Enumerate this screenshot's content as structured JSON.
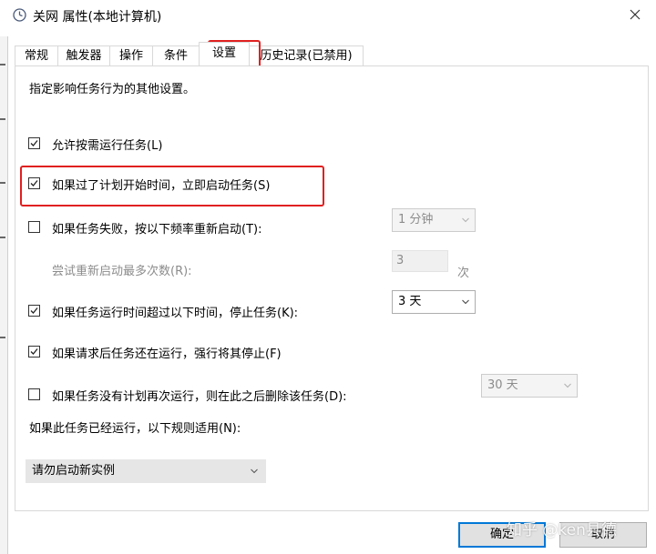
{
  "window": {
    "title": "关网 属性(本地计算机)"
  },
  "tabs": [
    {
      "label": "常规"
    },
    {
      "label": "触发器"
    },
    {
      "label": "操作"
    },
    {
      "label": "条件"
    },
    {
      "label": "设置",
      "active": true
    },
    {
      "label": "历史记录(已禁用)"
    }
  ],
  "settings": {
    "description": "指定影响任务行为的其他设置。",
    "allow_on_demand": {
      "label": "允许按需运行任务(L)",
      "checked": true
    },
    "run_asap_missed": {
      "label": "如果过了计划开始时间，立即启动任务(S)",
      "checked": true
    },
    "restart_on_fail": {
      "label": "如果任务失败，按以下频率重新启动(T):",
      "checked": false,
      "interval_value": "1 分钟",
      "attempts_label": "尝试重新启动最多次数(R):",
      "attempts_value": "3",
      "attempts_unit": "次"
    },
    "stop_if_longer": {
      "label": "如果任务运行时间超过以下时间，停止任务(K):",
      "checked": true,
      "value": "3 天"
    },
    "force_stop": {
      "label": "如果请求后任务还在运行，强行将其停止(F)",
      "checked": true
    },
    "delete_if_not_scheduled": {
      "label": "如果任务没有计划再次运行，则在此之后删除该任务(D):",
      "checked": false,
      "value": "30 天"
    },
    "rule_label": "如果此任务已经运行，以下规则适用(N):",
    "rule_value": "请勿启动新实例"
  },
  "buttons": {
    "ok": "确定",
    "cancel": "取消"
  },
  "watermark": "知乎 @ken县德",
  "colors": {
    "highlight": "#e02020",
    "accent": "#0078d7"
  }
}
